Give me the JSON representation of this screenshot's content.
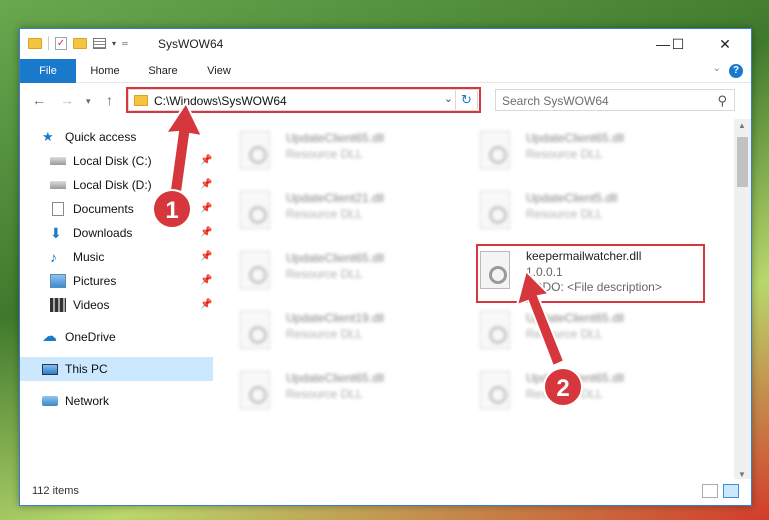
{
  "window": {
    "title": "SysWOW64"
  },
  "ribbon": {
    "tabs": [
      "File",
      "Home",
      "Share",
      "View"
    ]
  },
  "address": {
    "path": "C:\\Windows\\SysWOW64",
    "search_placeholder": "Search SysWOW64"
  },
  "nav": {
    "items": [
      {
        "label": "Quick access",
        "icon": "star-icon",
        "pinned": false
      },
      {
        "label": "Local Disk (C:)",
        "icon": "drive-icon",
        "pinned": true
      },
      {
        "label": "Local Disk (D:)",
        "icon": "drive-icon",
        "pinned": true
      },
      {
        "label": "Documents",
        "icon": "documents-icon",
        "pinned": true
      },
      {
        "label": "Downloads",
        "icon": "download-icon",
        "pinned": true
      },
      {
        "label": "Music",
        "icon": "music-icon",
        "pinned": true
      },
      {
        "label": "Pictures",
        "icon": "pictures-icon",
        "pinned": true
      },
      {
        "label": "Videos",
        "icon": "videos-icon",
        "pinned": true
      },
      {
        "label": "OneDrive",
        "icon": "cloud-icon",
        "pinned": false
      },
      {
        "label": "This PC",
        "icon": "computer-icon",
        "pinned": false,
        "selected": true
      },
      {
        "label": "Network",
        "icon": "network-icon",
        "pinned": false
      }
    ]
  },
  "files": [
    {
      "name": "UpdateClient65.dll",
      "type": "Resource DLL"
    },
    {
      "name": "UpdateClient65.dll",
      "type": "Resource DLL"
    },
    {
      "name": "UpdateClient21.dll",
      "type": "Resource DLL"
    },
    {
      "name": "UpdateClient5.dll",
      "type": "Resource DLL"
    },
    {
      "name": "UpdateClient65.dll",
      "type": "Resource DLL"
    },
    {
      "name": "keepermailwatcher.dll",
      "version": "1.0.0.1",
      "type": "TODO: <File description>"
    },
    {
      "name": "UpdateClient19.dll",
      "type": "Resource DLL"
    },
    {
      "name": "UpdateClient65.dll",
      "type": "Resource DLL"
    },
    {
      "name": "UpdateClient65.dll",
      "type": "Resource DLL"
    },
    {
      "name": "UpdateClient65.dll",
      "type": "Resource DLL"
    }
  ],
  "status": {
    "item_count": "112 items"
  },
  "annotations": {
    "step1": "1",
    "step2": "2",
    "color": "#d6373c"
  },
  "colors": {
    "accent": "#1979ca",
    "selection": "#cce8ff"
  }
}
